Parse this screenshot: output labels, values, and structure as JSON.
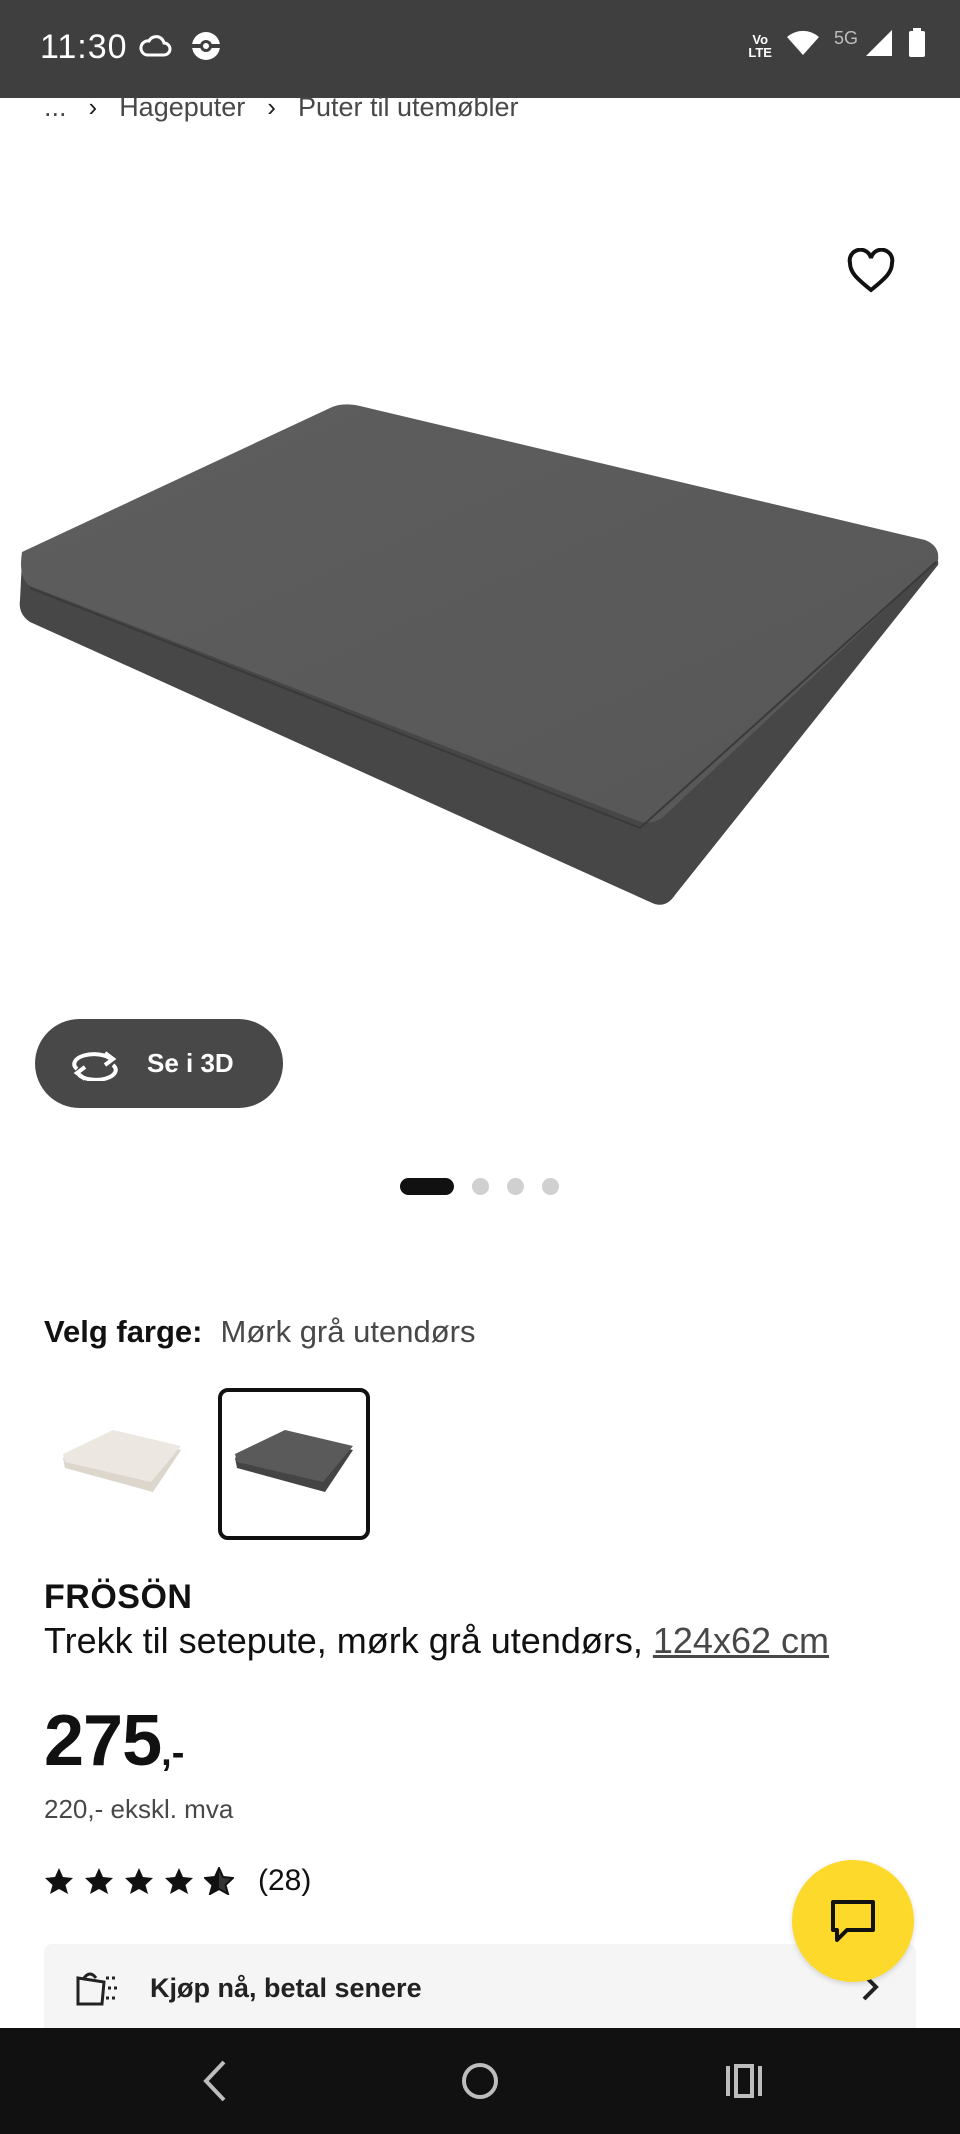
{
  "status_bar": {
    "time": "11:30",
    "network_label": "5G",
    "volte_line1": "Vo",
    "volte_line2": "LTE"
  },
  "breadcrumb": {
    "ellipsis": "...",
    "items": [
      "Hageputer",
      "Puter til utemøbler"
    ]
  },
  "gallery": {
    "see_3d_label": "Se i 3D",
    "dot_count": 4,
    "active_index": 0
  },
  "color_selector": {
    "label": "Velg farge:",
    "selected_value": "Mørk grå utendørs",
    "options": [
      "Beige",
      "Mørk grå utendørs"
    ],
    "selected_index": 1
  },
  "product": {
    "name": "FRÖSÖN",
    "description": "Trekk til setepute, mørk grå utendørs,",
    "measurement": "124x62 cm",
    "price": "275",
    "price_suffix": ",-",
    "price_excl_vat": "220,- ekskl. mva",
    "rating_stars": 4.5,
    "rating_count": "(28)"
  },
  "pay_later": {
    "label": "Kjøp nå, betal senere"
  },
  "colors": {
    "status_bar_bg": "#3f3f3f",
    "fab_yellow": "#fdd92b",
    "button_dark": "#484848",
    "nav_bg": "#111111"
  }
}
